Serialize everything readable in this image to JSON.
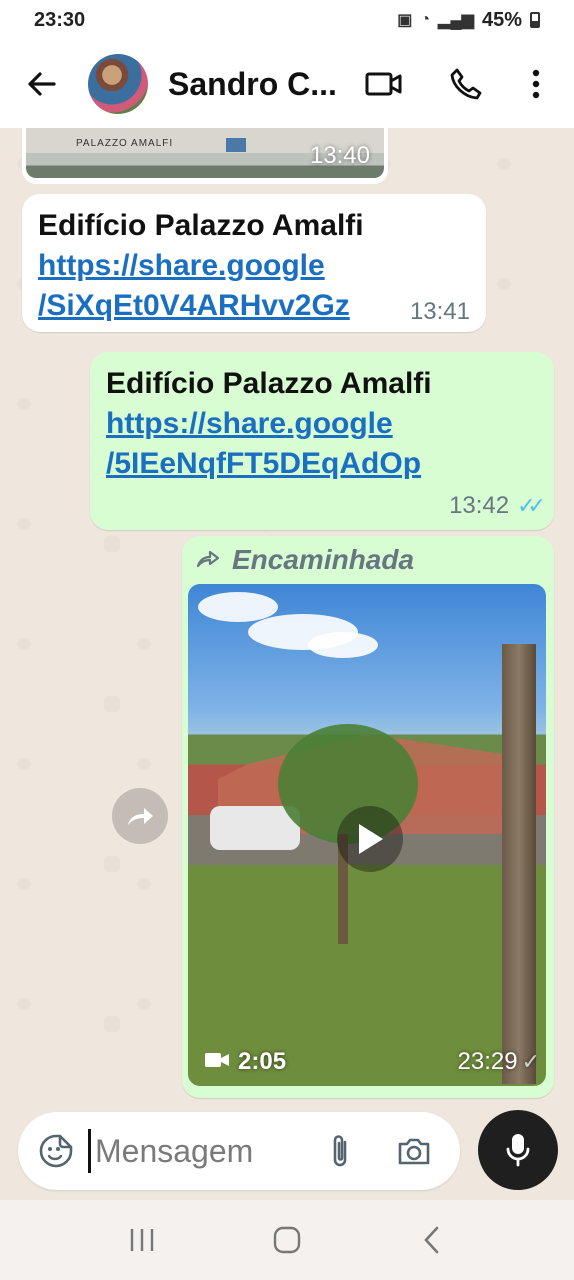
{
  "status_bar": {
    "time": "23:30",
    "battery": "45%"
  },
  "header": {
    "contact_name": "Sandro C..."
  },
  "messages": [
    {
      "type": "image",
      "direction": "in",
      "image_text": "PALAZZO AMALFI",
      "time": "13:40"
    },
    {
      "type": "link",
      "direction": "in",
      "title": "Edifício Palazzo Amalfi",
      "link_line1": "https://share.google",
      "link_line2": "/SiXqEt0V4ARHvv2Gz",
      "time": "13:41"
    },
    {
      "type": "link",
      "direction": "out",
      "title": "Edifício Palazzo Amalfi",
      "link_line1": "https://share.google",
      "link_line2": "/5IEeNqfFT5DEqAdOp",
      "time": "13:42",
      "status": "read"
    },
    {
      "type": "video",
      "direction": "out",
      "forwarded_label": "Encaminhada",
      "duration": "2:05",
      "time": "23:29",
      "status": "sent"
    }
  ],
  "input": {
    "placeholder": "Mensagem"
  },
  "colors": {
    "incoming_bubble": "#ffffff",
    "outgoing_bubble": "#d9fdd3",
    "link": "#1b6fc1",
    "read_ticks": "#53bdeb",
    "chat_background": "#efe7dd"
  },
  "icons": {
    "header": [
      "back-arrow-icon",
      "video-call-icon",
      "voice-call-icon",
      "more-options-icon"
    ],
    "input": [
      "sticker-icon",
      "attach-icon",
      "camera-icon",
      "microphone-icon"
    ],
    "nav": [
      "recent-apps-icon",
      "home-icon",
      "back-icon"
    ]
  }
}
